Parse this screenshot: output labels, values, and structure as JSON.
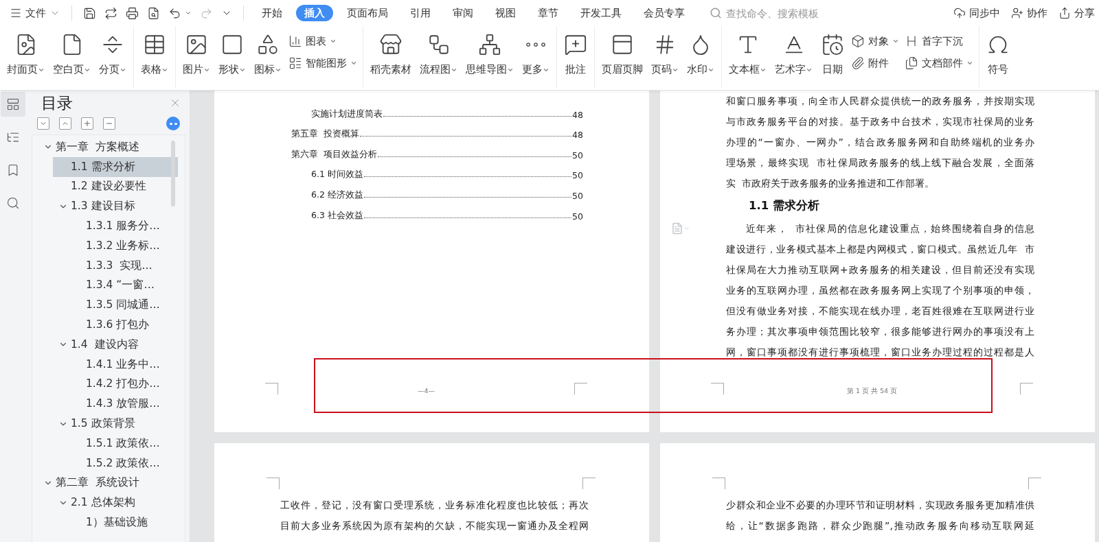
{
  "menu": {
    "file_label": "文件",
    "tabs": [
      {
        "label": "开始",
        "selected": false
      },
      {
        "label": "插入",
        "selected": true
      },
      {
        "label": "页面布局",
        "selected": false
      },
      {
        "label": "引用",
        "selected": false
      },
      {
        "label": "审阅",
        "selected": false
      },
      {
        "label": "视图",
        "selected": false
      },
      {
        "label": "章节",
        "selected": false
      },
      {
        "label": "开发工具",
        "selected": false
      },
      {
        "label": "会员专享",
        "selected": false
      }
    ],
    "search": {
      "placeholder": "查找命令、搜索模板"
    },
    "actions": [
      {
        "label": "同步中"
      },
      {
        "label": "协作"
      },
      {
        "label": "分享"
      }
    ]
  },
  "ribbon": {
    "groups": [
      {
        "items": [
          {
            "kind": "large",
            "label": "封面页",
            "menu": true
          },
          {
            "kind": "large",
            "label": "空白页",
            "menu": true
          },
          {
            "kind": "large",
            "label": "分页",
            "menu": true
          }
        ]
      },
      {
        "items": [
          {
            "kind": "large",
            "label": "表格",
            "menu": true
          }
        ]
      },
      {
        "items": [
          {
            "kind": "large",
            "label": "图片",
            "menu": true
          },
          {
            "kind": "large",
            "label": "形状",
            "menu": true
          },
          {
            "kind": "large",
            "label": "图标",
            "menu": true
          },
          {
            "kind": "stack",
            "items": [
              {
                "label": "图表",
                "menu": true
              },
              {
                "label": "智能图形",
                "menu": true
              }
            ]
          }
        ]
      },
      {
        "items": [
          {
            "kind": "large",
            "label": "稻壳素材",
            "menu": false
          },
          {
            "kind": "large",
            "label": "流程图",
            "menu": true
          },
          {
            "kind": "large",
            "label": "思维导图",
            "menu": true
          },
          {
            "kind": "large",
            "label": "更多",
            "menu": true
          }
        ]
      },
      {
        "items": [
          {
            "kind": "large",
            "label": "批注",
            "menu": false
          }
        ]
      },
      {
        "items": [
          {
            "kind": "large",
            "label": "页眉页脚",
            "menu": false
          },
          {
            "kind": "large",
            "label": "页码",
            "menu": true
          },
          {
            "kind": "large",
            "label": "水印",
            "menu": true
          }
        ]
      },
      {
        "items": [
          {
            "kind": "large",
            "label": "文本框",
            "menu": true
          },
          {
            "kind": "large",
            "label": "艺术字",
            "menu": true
          },
          {
            "kind": "large",
            "label": "日期",
            "menu": false
          },
          {
            "kind": "stack",
            "items": [
              {
                "label": "对象",
                "menu": true
              },
              {
                "label": "附件",
                "menu": false
              }
            ]
          },
          {
            "kind": "stack",
            "items": [
              {
                "label": "首字下沉",
                "menu": false
              },
              {
                "label": "文档部件",
                "menu": true
              }
            ]
          }
        ]
      },
      {
        "items": [
          {
            "kind": "large",
            "label": "符号",
            "menu": false
          }
        ]
      }
    ]
  },
  "sidebar": {
    "title": "目录",
    "tree": [
      {
        "label": "第一章  方案概述",
        "selected": false,
        "expanded": true,
        "children": [
          {
            "label": "1.1 需求分析",
            "selected": true
          },
          {
            "label": "1.2 建设必要性",
            "selected": false
          },
          {
            "label": "1.3 建设目标",
            "selected": false,
            "expanded": true,
            "children": [
              {
                "label": "1.3.1 服务分…",
                "selected": false
              },
              {
                "label": "1.3.2 业务标…",
                "selected": false
              },
              {
                "label": "1.3.3  实现…",
                "selected": false
              },
              {
                "label": "1.3.4 “一窗…",
                "selected": false
              },
              {
                "label": "1.3.5 同城通…",
                "selected": false
              },
              {
                "label": "1.3.6 打包办",
                "selected": false
              }
            ]
          },
          {
            "label": "1.4  建设内容",
            "selected": false,
            "expanded": true,
            "children": [
              {
                "label": "1.4.1 业务中…",
                "selected": false
              },
              {
                "label": "1.4.2 打包办…",
                "selected": false
              },
              {
                "label": "1.4.3 放管服…",
                "selected": false
              }
            ]
          },
          {
            "label": "1.5 政策背景",
            "selected": false,
            "expanded": true,
            "children": [
              {
                "label": "1.5.1 政策依…",
                "selected": false
              },
              {
                "label": "1.5.2 政策依…",
                "selected": false
              }
            ]
          }
        ]
      },
      {
        "label": "第二章  系统设计",
        "selected": false,
        "expanded": true,
        "children": [
          {
            "label": "2.1 总体架构",
            "selected": false,
            "expanded": true,
            "children": [
              {
                "label": "1）基础设施",
                "selected": false
              }
            ]
          }
        ]
      }
    ]
  },
  "document": {
    "rows": [
      {
        "pages": [
          {
            "kind": "toc",
            "entries": [
              {
                "kind": "section",
                "title": "实施计划进度简表",
                "page": "48"
              },
              {
                "kind": "chapter",
                "title": "第五章  投资概算",
                "page": "48"
              },
              {
                "kind": "chapter",
                "title": "第六章  项目效益分析",
                "page": "50"
              },
              {
                "kind": "section",
                "title": "6.1 时间效益",
                "page": "50"
              },
              {
                "kind": "section",
                "title": "6.2 经济效益",
                "page": "50"
              },
              {
                "kind": "section",
                "title": "6.3 社会效益",
                "page": "50"
              }
            ],
            "footer": "—4—"
          },
          {
            "kind": "text",
            "blocks": [
              {
                "kind": "paragraph",
                "first_line_indent": false,
                "complete": true,
                "lines": [
                  "和窗口服务事项，向全市人民群众提供统一的政务服务，并按期实现",
                  "与市政务服务平台的对接。基于政务中台技术，实现市社保局的业务",
                  "办理的“一窗办、一网办”，结合政务服务网和自助终端机的业务办",
                  "理场景，最终实现  市社保局政务服务的线上线下融合发展，全面落",
                  "实  市政府关于政务服务的业务推进和工作部署。"
                ]
              },
              {
                "kind": "heading",
                "text": "1.1 需求分析"
              },
              {
                "kind": "margin_icon"
              },
              {
                "kind": "paragraph",
                "first_line_indent": true,
                "complete": false,
                "lines": [
                  "近年来，  市社保局的信息化建设重点，始终围绕着自身的信息",
                  "建设进行，业务模式基本上都是内网模式，窗口模式。虽然近几年  市",
                  "社保局在大力推动互联网+政务服务的相关建设，但目前还没有实现",
                  "业务的互联网办理，虽然都在政务服务网上实现了个别事项的申领，",
                  "但没有做业务对接，不能实现在线办理，老百姓很难在互联网进行业",
                  "务办理；其次事项申领范围比较窄，很多能够进行网办的事项没有上",
                  "网，窗口事项都没有进行事项梳理，窗口业务办理过程的过程都是人"
                ]
              }
            ],
            "footer": "第 1 页 共 54 页"
          }
        ]
      },
      {
        "pages": [
          {
            "kind": "text",
            "blocks": [
              {
                "kind": "paragraph",
                "first_line_indent": false,
                "complete": false,
                "lines": [
                  "工收件，登记，没有窗口受理系统，业务标准化程度也比较低；再次",
                  "目前大多业务系统因为原有架构的欠缺，不能实现一窗通办及全程网"
                ]
              }
            ]
          },
          {
            "kind": "text",
            "blocks": [
              {
                "kind": "paragraph",
                "first_line_indent": false,
                "complete": false,
                "lines": [
                  "少群众和企业不必要的办理环节和证明材料，实现政务服务更加精准供",
                  "给，让“数据多跑路，群众少跑腿”,推动政务服务向移动互联网延"
                ]
              }
            ]
          }
        ]
      }
    ]
  }
}
